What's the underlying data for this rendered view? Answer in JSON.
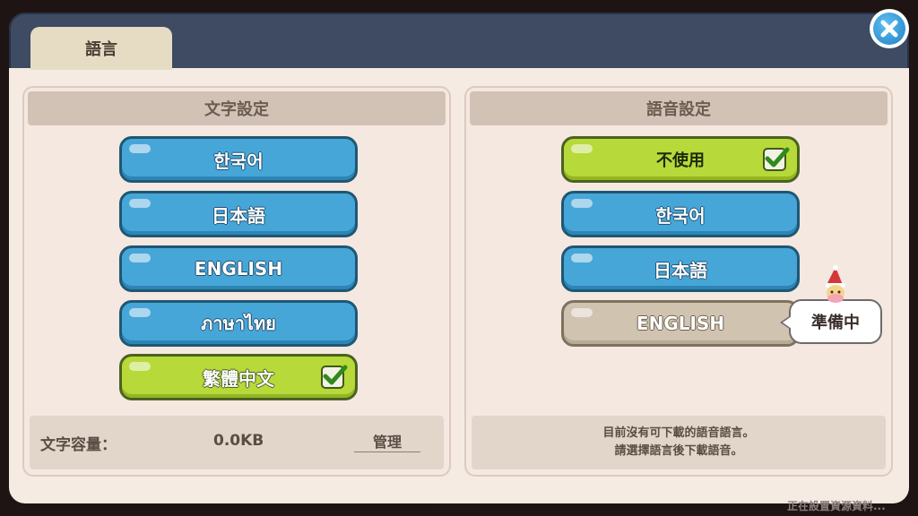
{
  "tab": {
    "label": "語言"
  },
  "left_panel": {
    "title": "文字設定",
    "buttons": [
      {
        "label": "한국어",
        "state": "normal"
      },
      {
        "label": "日本語",
        "state": "normal"
      },
      {
        "label": "ENGLISH",
        "state": "normal"
      },
      {
        "label": "ภาษาไทย",
        "state": "normal"
      },
      {
        "label": "繁體中文",
        "state": "selected"
      }
    ],
    "capacity_label": "文字容量：",
    "capacity_value": "0.0KB",
    "manage_label": "管理"
  },
  "right_panel": {
    "title": "語音設定",
    "buttons": [
      {
        "label": "不使用",
        "state": "selected"
      },
      {
        "label": "한국어",
        "state": "normal"
      },
      {
        "label": "日本語",
        "state": "normal"
      },
      {
        "label": "ENGLISH",
        "state": "disabled"
      }
    ],
    "tooltip": "準備中",
    "note_line1": "目前沒有可下載的語音語言。",
    "note_line2": "請選擇語言後下載語音。"
  },
  "status_text": "正在設置資源資料...",
  "colors": {
    "dialog_frame": "#3e4b63",
    "panel_bg": "#f4e8e0",
    "button_blue": "#47a6d8",
    "button_green": "#b8d93a",
    "button_disabled": "#d0c4b1",
    "close_button": "#2f8fd8"
  },
  "icons": {
    "close": "close-icon",
    "check": "checkmark-icon",
    "sprite": "cookie-character-icon"
  }
}
